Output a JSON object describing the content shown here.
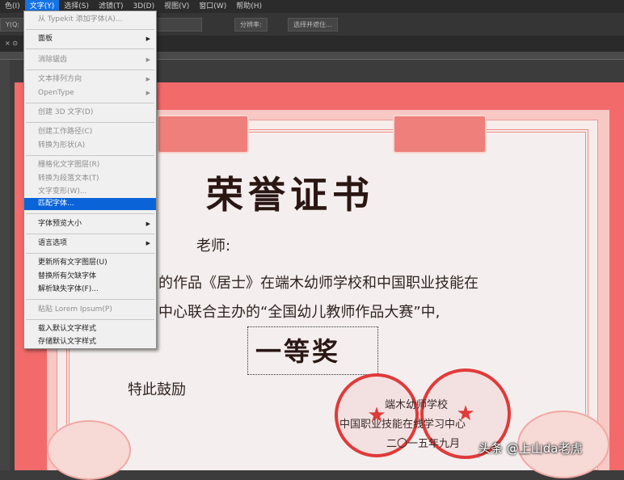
{
  "menubar": {
    "items": [
      {
        "label": "色(I)",
        "active": false
      },
      {
        "label": "文字(Y)",
        "active": true
      },
      {
        "label": "选择(S)",
        "active": false
      },
      {
        "label": "滤镜(T)",
        "active": false
      },
      {
        "label": "3D(D)",
        "active": false
      },
      {
        "label": "视图(V)",
        "active": false
      },
      {
        "label": "窗口(W)",
        "active": false
      },
      {
        "label": "帮助(H)",
        "active": false
      }
    ]
  },
  "options_bar": {
    "prefix": "Y(Q:",
    "resolution_label": "分辨率:",
    "select_subject_button": "选择并遮住..."
  },
  "document_tab": "× ⊙",
  "text_menu": {
    "items": [
      {
        "label": "从 Typekit 添加字体(A)...",
        "disabled": true,
        "submenu": false,
        "highlight": false
      },
      {
        "label": "面板",
        "disabled": false,
        "submenu": true,
        "highlight": false
      },
      {
        "label": "消除锯齿",
        "disabled": true,
        "submenu": true,
        "highlight": false
      },
      {
        "label": "文本排列方向",
        "disabled": true,
        "submenu": true,
        "highlight": false
      },
      {
        "label": "OpenType",
        "disabled": true,
        "submenu": true,
        "highlight": false
      },
      {
        "label": "创建 3D 文字(D)",
        "disabled": true,
        "submenu": false,
        "highlight": false
      },
      {
        "label": "创建工作路径(C)",
        "disabled": true,
        "submenu": false,
        "highlight": false
      },
      {
        "label": "转换为形状(A)",
        "disabled": true,
        "submenu": false,
        "highlight": false
      },
      {
        "label": "栅格化文字图层(R)",
        "disabled": true,
        "submenu": false,
        "highlight": false
      },
      {
        "label": "转换为段落文本(T)",
        "disabled": true,
        "submenu": false,
        "highlight": false
      },
      {
        "label": "文字变形(W)...",
        "disabled": true,
        "submenu": false,
        "highlight": false
      },
      {
        "label": "匹配字体...",
        "disabled": false,
        "submenu": false,
        "highlight": true
      },
      {
        "label": "字体预览大小",
        "disabled": false,
        "submenu": true,
        "highlight": false
      },
      {
        "label": "语言选项",
        "disabled": false,
        "submenu": true,
        "highlight": false
      },
      {
        "label": "更新所有文字图层(U)",
        "disabled": false,
        "submenu": false,
        "highlight": false
      },
      {
        "label": "替换所有欠缺字体",
        "disabled": false,
        "submenu": false,
        "highlight": false
      },
      {
        "label": "解析缺失字体(F)...",
        "disabled": false,
        "submenu": false,
        "highlight": false
      },
      {
        "label": "粘贴 Lorem Ipsum(P)",
        "disabled": true,
        "submenu": false,
        "highlight": false
      },
      {
        "label": "载入默认文字样式",
        "disabled": false,
        "submenu": false,
        "highlight": false
      },
      {
        "label": "存储默认文字样式",
        "disabled": false,
        "submenu": false,
        "highlight": false
      }
    ]
  },
  "certificate": {
    "title": "荣誉证书",
    "recipient": "老师:",
    "line1": "的作品《居士》在端木幼师学校和中国职业技能在",
    "line2": "中心联合主办的“全国幼儿教师作品大赛”中,",
    "award": "一等奖",
    "closing": "特此鼓励",
    "issuer1": "端木幼师学校",
    "issuer2": "中国职业技能在线学习中心",
    "date": "二〇一五年九月"
  },
  "watermark": "头条 @上山da老虎",
  "colors": {
    "highlight": "#0a64d8",
    "menu_bg": "#f0f0f0",
    "certificate_red": "#f26a6a",
    "seal_red": "#e03a3a"
  }
}
